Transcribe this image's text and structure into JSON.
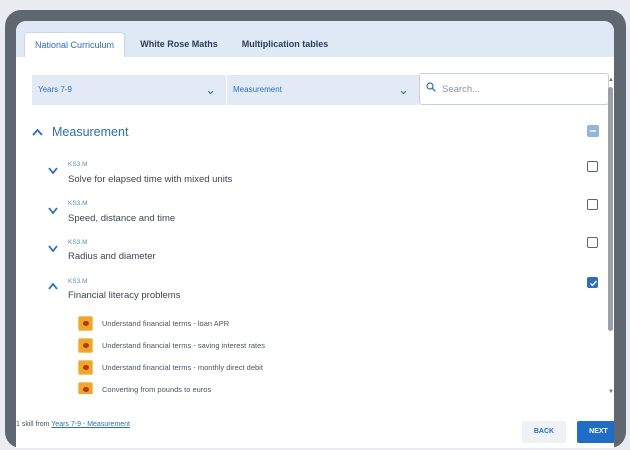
{
  "tabs": [
    {
      "label": "National Curriculum",
      "active": true
    },
    {
      "label": "White Rose Maths",
      "active": false
    },
    {
      "label": "Multiplication tables",
      "active": false
    }
  ],
  "filters": {
    "year": "Years 7-9",
    "topic": "Measurement",
    "search_placeholder": "Search..."
  },
  "section": {
    "title": "Measurement",
    "state": "partially-selected"
  },
  "items": [
    {
      "code": "KS3.M",
      "title": "Solve for elapsed time with mixed units",
      "checked": false,
      "expanded": false
    },
    {
      "code": "KS3.M",
      "title": "Speed, distance and time",
      "checked": false,
      "expanded": false
    },
    {
      "code": "KS3.M",
      "title": "Radius and diameter",
      "checked": false,
      "expanded": false
    },
    {
      "code": "KS3.M",
      "title": "Financial literacy problems",
      "checked": true,
      "expanded": true
    }
  ],
  "skills": [
    {
      "label": "Understand financial terms - loan APR"
    },
    {
      "label": "Understand financial terms - saving interest rates"
    },
    {
      "label": "Understand financial terms - monthly direct debit"
    },
    {
      "label": "Converting from pounds to euros"
    }
  ],
  "footer": {
    "prefix": "1 skill from ",
    "link": "Years 7-9 - Measurement"
  },
  "buttons": {
    "back": "BACK",
    "next": "NEXT"
  },
  "colors": {
    "accent": "#2a6fc2",
    "skill_icon": "#f0a726",
    "frame": "#5f6770"
  }
}
